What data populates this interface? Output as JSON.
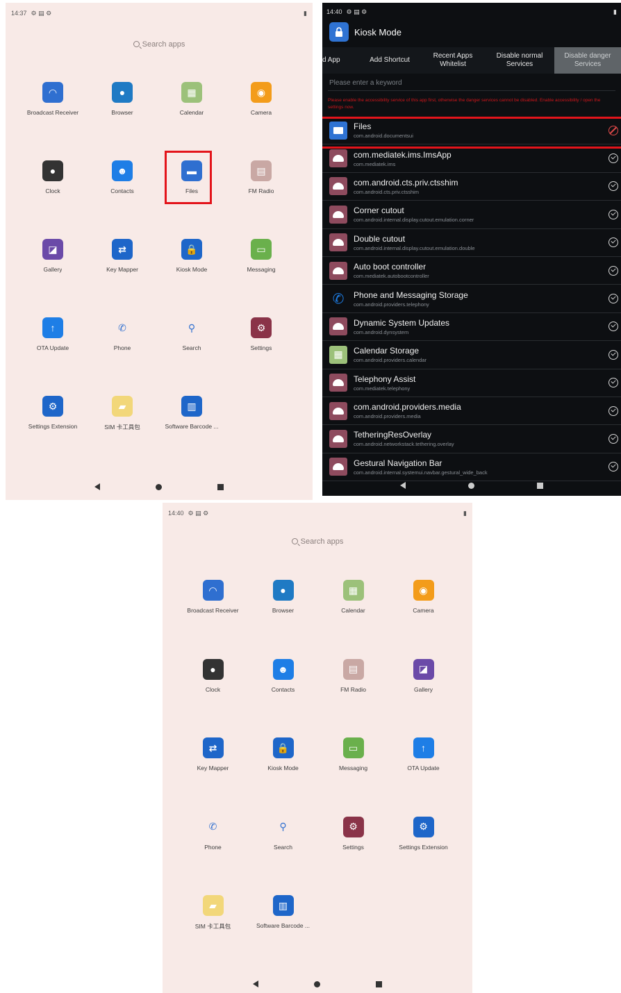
{
  "launcher1": {
    "time": "14:37",
    "search_placeholder": "Search apps",
    "apps": [
      {
        "label": "Broadcast Receiver",
        "icon": "broadcast-icon",
        "color": "#2f6fd0",
        "glyph": "◠"
      },
      {
        "label": "Browser",
        "icon": "globe-icon",
        "color": "#1f7ac4",
        "glyph": "●"
      },
      {
        "label": "Calendar",
        "icon": "calendar-icon",
        "color": "#9cc17a",
        "glyph": "▦"
      },
      {
        "label": "Camera",
        "icon": "camera-icon",
        "color": "#f39c1a",
        "glyph": "◉"
      },
      {
        "label": "Clock",
        "icon": "clock-icon",
        "color": "#333333",
        "glyph": "●"
      },
      {
        "label": "Contacts",
        "icon": "contacts-icon",
        "color": "#1e7ee6",
        "glyph": "☻"
      },
      {
        "label": "Files",
        "icon": "folder-icon",
        "color": "#2f6fd0",
        "glyph": "▬"
      },
      {
        "label": "FM Radio",
        "icon": "radio-icon",
        "color": "#c9a8a4",
        "glyph": "▤"
      },
      {
        "label": "Gallery",
        "icon": "gallery-icon",
        "color": "#6b4aa8",
        "glyph": "◪"
      },
      {
        "label": "Key Mapper",
        "icon": "keymapper-icon",
        "color": "#1e66c9",
        "glyph": "⇄"
      },
      {
        "label": "Kiosk Mode",
        "icon": "lock-icon",
        "color": "#1e66c9",
        "glyph": "🔒"
      },
      {
        "label": "Messaging",
        "icon": "message-icon",
        "color": "#6ab04c",
        "glyph": "▭"
      },
      {
        "label": "OTA Update",
        "icon": "upload-icon",
        "color": "#1e7ee6",
        "glyph": "↑"
      },
      {
        "label": "Phone",
        "icon": "phone-icon",
        "color": "#ffffff",
        "glyph": "✆"
      },
      {
        "label": "Search",
        "icon": "search-icon",
        "color": "#ffffff",
        "glyph": "⚲"
      },
      {
        "label": "Settings",
        "icon": "settings-icon",
        "color": "#8a3348",
        "glyph": "⚙"
      },
      {
        "label": "Settings Extension",
        "icon": "settings-ext-icon",
        "color": "#1e66c9",
        "glyph": "⚙"
      },
      {
        "label": "SIM 卡工具包",
        "icon": "sim-icon",
        "color": "#f2d77a",
        "glyph": "▰"
      },
      {
        "label": "Software Barcode ...",
        "icon": "barcode-icon",
        "color": "#1e66c9",
        "glyph": "▥"
      }
    ],
    "highlighted": "Files"
  },
  "kiosk": {
    "time": "14:40",
    "title": "Kiosk Mode",
    "tabs": [
      "d App",
      "Add Shortcut",
      "Recent Apps Whitelist",
      "Disable normal Services",
      "Disable danger Services"
    ],
    "active_tab": "Disable danger Services",
    "keyword_placeholder": "Please enter a keyword",
    "warning": "Please enable the accessibility service of this app first, otherwise the danger services cannot be disabled. Enable accessibility / open the settings now.",
    "rows": [
      {
        "name": "Files",
        "pkg": "com.android.documentsui",
        "state": "disabled",
        "icon": "folder-icon"
      },
      {
        "name": "com.mediatek.ims.ImsApp",
        "pkg": "com.mediatek.ims",
        "state": "enabled",
        "icon": "android-icon"
      },
      {
        "name": "com.android.cts.priv.ctsshim",
        "pkg": "com.android.cts.priv.ctsshim",
        "state": "enabled",
        "icon": "android-icon"
      },
      {
        "name": "Corner cutout",
        "pkg": "com.android.internal.display.cutout.emulation.corner",
        "state": "enabled",
        "icon": "android-icon"
      },
      {
        "name": "Double cutout",
        "pkg": "com.android.internal.display.cutout.emulation.double",
        "state": "enabled",
        "icon": "android-icon"
      },
      {
        "name": "Auto boot controller",
        "pkg": "com.mediatek.autobootcontroller",
        "state": "enabled",
        "icon": "android-icon"
      },
      {
        "name": "Phone and Messaging Storage",
        "pkg": "com.android.providers.telephony",
        "state": "enabled",
        "icon": "phone-icon"
      },
      {
        "name": "Dynamic System Updates",
        "pkg": "com.android.dynsystem",
        "state": "enabled",
        "icon": "android-icon"
      },
      {
        "name": "Calendar Storage",
        "pkg": "com.android.providers.calendar",
        "state": "enabled",
        "icon": "calendar-icon"
      },
      {
        "name": "Telephony Assist",
        "pkg": "com.mediatek.telephony",
        "state": "enabled",
        "icon": "android-icon"
      },
      {
        "name": "com.android.providers.media",
        "pkg": "com.android.providers.media",
        "state": "enabled",
        "icon": "android-icon"
      },
      {
        "name": "TetheringResOverlay",
        "pkg": "com.android.networkstack.tethering.overlay",
        "state": "enabled",
        "icon": "android-icon"
      },
      {
        "name": "Gestural Navigation Bar",
        "pkg": "com.android.internal.systemui.navbar.gestural_wide_back",
        "state": "enabled",
        "icon": "android-icon"
      }
    ]
  },
  "launcher2": {
    "time": "14:40",
    "search_placeholder": "Search apps",
    "apps": [
      {
        "label": "Broadcast Receiver",
        "icon": "broadcast-icon",
        "color": "#2f6fd0",
        "glyph": "◠"
      },
      {
        "label": "Browser",
        "icon": "globe-icon",
        "color": "#1f7ac4",
        "glyph": "●"
      },
      {
        "label": "Calendar",
        "icon": "calendar-icon",
        "color": "#9cc17a",
        "glyph": "▦"
      },
      {
        "label": "Camera",
        "icon": "camera-icon",
        "color": "#f39c1a",
        "glyph": "◉"
      },
      {
        "label": "Clock",
        "icon": "clock-icon",
        "color": "#333333",
        "glyph": "●"
      },
      {
        "label": "Contacts",
        "icon": "contacts-icon",
        "color": "#1e7ee6",
        "glyph": "☻"
      },
      {
        "label": "FM Radio",
        "icon": "radio-icon",
        "color": "#c9a8a4",
        "glyph": "▤"
      },
      {
        "label": "Gallery",
        "icon": "gallery-icon",
        "color": "#6b4aa8",
        "glyph": "◪"
      },
      {
        "label": "Key Mapper",
        "icon": "keymapper-icon",
        "color": "#1e66c9",
        "glyph": "⇄"
      },
      {
        "label": "Kiosk Mode",
        "icon": "lock-icon",
        "color": "#1e66c9",
        "glyph": "🔒"
      },
      {
        "label": "Messaging",
        "icon": "message-icon",
        "color": "#6ab04c",
        "glyph": "▭"
      },
      {
        "label": "OTA Update",
        "icon": "upload-icon",
        "color": "#1e7ee6",
        "glyph": "↑"
      },
      {
        "label": "Phone",
        "icon": "phone-icon",
        "color": "#ffffff",
        "glyph": "✆"
      },
      {
        "label": "Search",
        "icon": "search-icon",
        "color": "#ffffff",
        "glyph": "⚲"
      },
      {
        "label": "Settings",
        "icon": "settings-icon",
        "color": "#8a3348",
        "glyph": "⚙"
      },
      {
        "label": "Settings Extension",
        "icon": "settings-ext-icon",
        "color": "#1e66c9",
        "glyph": "⚙"
      },
      {
        "label": "SIM 卡工具包",
        "icon": "sim-icon",
        "color": "#f2d77a",
        "glyph": "▰"
      },
      {
        "label": "Software Barcode ...",
        "icon": "barcode-icon",
        "color": "#1e66c9",
        "glyph": "▥"
      }
    ]
  }
}
